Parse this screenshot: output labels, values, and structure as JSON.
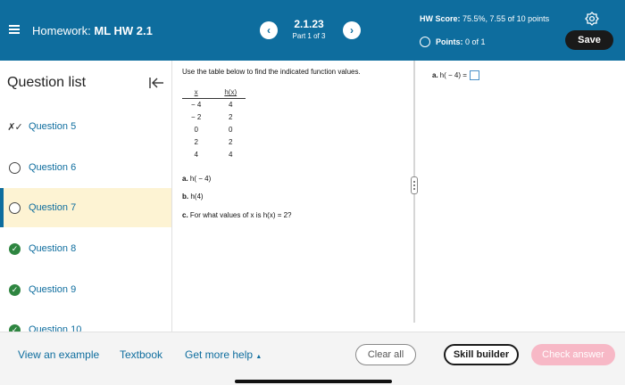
{
  "header": {
    "title_prefix": "Homework:",
    "title_name": "ML HW 2.1",
    "question_number": "2.1.23",
    "part_text": "Part 1 of 3",
    "prev_symbol": "‹",
    "next_symbol": "›",
    "hw_score_label": "HW Score:",
    "hw_score_value": "75.5%, 7.55 of 10 points",
    "points_label": "Points:",
    "points_value": "0 of 1",
    "save_label": "Save",
    "icons": {
      "menu": "menu-icon",
      "settings": "gear-icon"
    }
  },
  "sidebar": {
    "title": "Question list",
    "collapse_icon": "collapse-left-icon",
    "items": [
      {
        "label": "Question 5",
        "status": "partial",
        "icon": "partial-credit-icon"
      },
      {
        "label": "Question 6",
        "status": "unanswered",
        "icon": "unanswered-circle-icon"
      },
      {
        "label": "Question 7",
        "status": "current",
        "icon": "unanswered-circle-icon"
      },
      {
        "label": "Question 8",
        "status": "correct",
        "icon": "checkmark-icon"
      },
      {
        "label": "Question 9",
        "status": "correct",
        "icon": "checkmark-icon"
      },
      {
        "label": "Question 10",
        "status": "correct",
        "icon": "checkmark-icon"
      }
    ]
  },
  "question": {
    "instruction": "Use the table below to find the indicated function values.",
    "table": {
      "headers": [
        "x",
        "h(x)"
      ],
      "rows": [
        [
          "− 4",
          "4"
        ],
        [
          "− 2",
          "2"
        ],
        [
          "0",
          "0"
        ],
        [
          "2",
          "2"
        ],
        [
          "4",
          "4"
        ]
      ]
    },
    "parts": [
      {
        "letter": "a.",
        "text": "h( − 4)"
      },
      {
        "letter": "b.",
        "text": "h(4)"
      },
      {
        "letter": "c.",
        "text": "For what values of x is h(x) = 2?"
      }
    ]
  },
  "answer": {
    "letter": "a.",
    "prompt": "h( − 4) =",
    "value": ""
  },
  "footer": {
    "view_example": "View an example",
    "textbook": "Textbook",
    "get_more_help": "Get more help",
    "clear_all": "Clear all",
    "skill_builder": "Skill builder",
    "check_answer": "Check answer"
  },
  "colors": {
    "header_bg": "#0e6d9e",
    "accent": "#0e6d9e",
    "active_row": "#fdf3d3",
    "correct": "#2e8540",
    "check_answer_disabled": "#f7b8c6"
  }
}
